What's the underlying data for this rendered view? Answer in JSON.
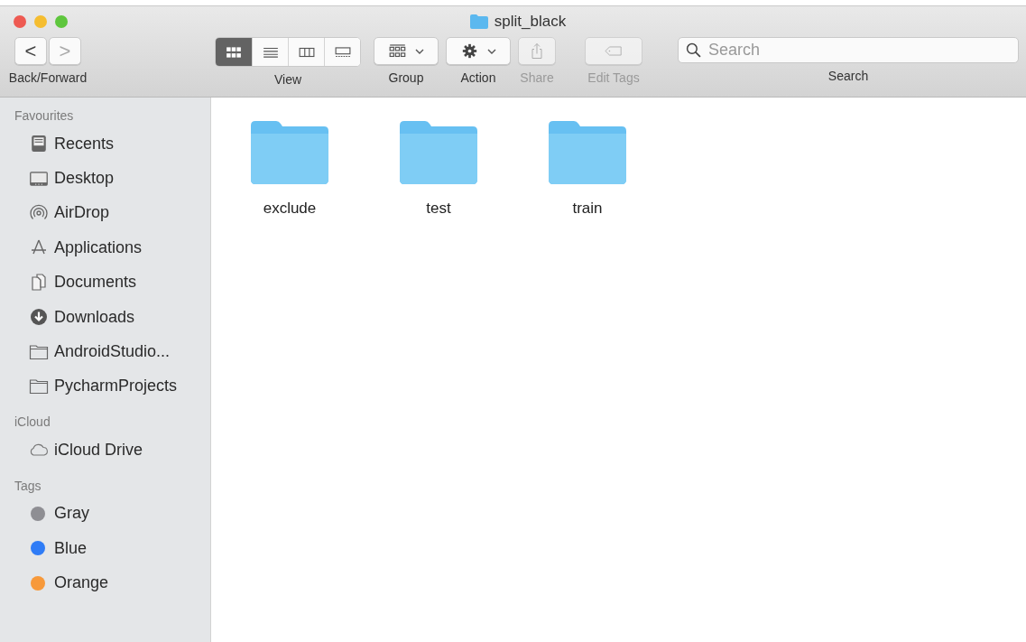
{
  "window": {
    "title": "split_black"
  },
  "toolbar": {
    "back_forward": {
      "back": "<",
      "forward": ">",
      "label": "Back/Forward"
    },
    "view": {
      "label": "View",
      "modes": [
        {
          "kind": "icons",
          "selected": true
        },
        {
          "kind": "list",
          "selected": false
        },
        {
          "kind": "columns",
          "selected": false
        },
        {
          "kind": "gallery",
          "selected": false
        }
      ]
    },
    "group": {
      "label": "Group"
    },
    "action": {
      "label": "Action"
    },
    "share": {
      "label": "Share",
      "disabled": true
    },
    "edit_tags": {
      "label": "Edit Tags",
      "disabled": true
    },
    "search": {
      "placeholder": "Search",
      "label": "Search"
    }
  },
  "sidebar": {
    "sections": [
      {
        "title": "Favourites",
        "items": [
          {
            "label": "Recents",
            "kind": "recents"
          },
          {
            "label": "Desktop",
            "kind": "desktop"
          },
          {
            "label": "AirDrop",
            "kind": "airdrop"
          },
          {
            "label": "Applications",
            "kind": "applications"
          },
          {
            "label": "Documents",
            "kind": "documents"
          },
          {
            "label": "Downloads",
            "kind": "downloads"
          },
          {
            "label": "AndroidStudio...",
            "kind": "folder"
          },
          {
            "label": "PycharmProjects",
            "kind": "folder"
          }
        ]
      },
      {
        "title": "iCloud",
        "items": [
          {
            "label": "iCloud Drive",
            "kind": "cloud"
          }
        ]
      },
      {
        "title": "Tags",
        "items": [
          {
            "label": "Gray",
            "kind": "tag",
            "color": "#8e8e93"
          },
          {
            "label": "Blue",
            "kind": "tag",
            "color": "#2f7cf6"
          },
          {
            "label": "Orange",
            "kind": "tag",
            "color": "#f7993a"
          }
        ]
      }
    ]
  },
  "files": [
    {
      "name": "exclude"
    },
    {
      "name": "test"
    },
    {
      "name": "train"
    }
  ]
}
